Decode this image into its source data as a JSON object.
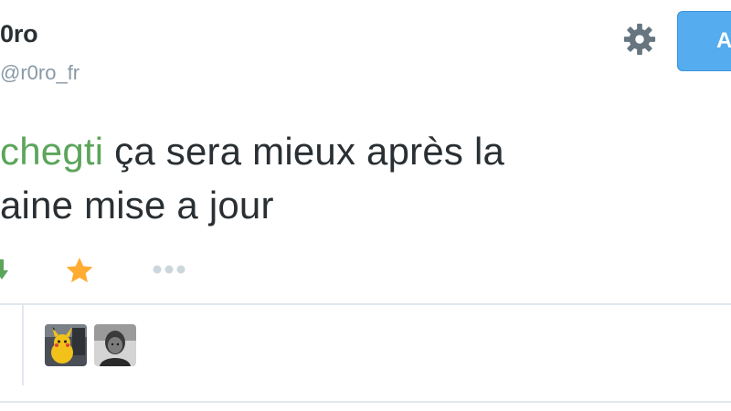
{
  "profile": {
    "display_name": "0ro",
    "handle": "@r0ro_fr",
    "follow_label": "A"
  },
  "tweet": {
    "mention": "chegti",
    "line1_rest": " ça sera mieux après la",
    "line2": "aine mise a jour"
  },
  "actions": {
    "retweet_icon": "retweet-icon",
    "favorite_icon": "star-icon",
    "more_icon": "more-dots-icon"
  },
  "favorited_by": {
    "avatars": [
      "avatar-pikachu",
      "avatar-person"
    ]
  },
  "colors": {
    "mention": "#5ba55b",
    "star": "#ffac33",
    "follow_button": "#55acee",
    "retweet": "#5ba55b",
    "muted": "#8899a6",
    "divider": "#e1e8ed"
  }
}
